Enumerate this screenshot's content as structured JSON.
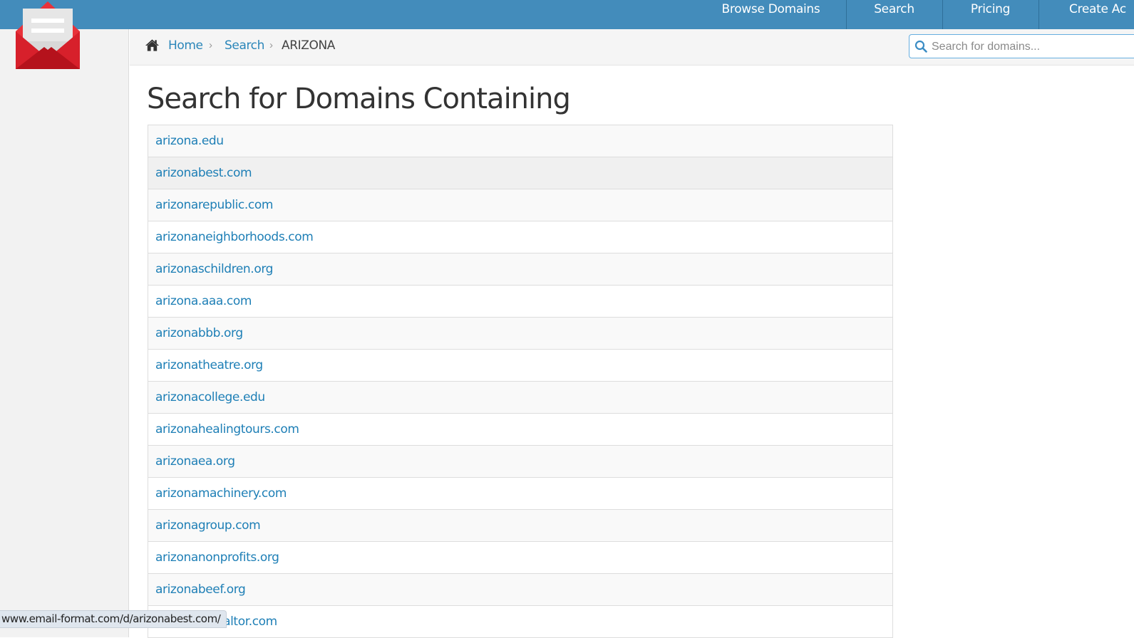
{
  "nav": {
    "items": [
      {
        "label": "Browse Domains"
      },
      {
        "label": "Search"
      },
      {
        "label": "Pricing"
      },
      {
        "label": "Create Ac"
      }
    ]
  },
  "breadcrumb": {
    "home": "Home",
    "search": "Search",
    "current": "ARIZONA"
  },
  "search": {
    "placeholder": "Search for domains..."
  },
  "page": {
    "title": "Search for Domains Containing"
  },
  "domains": [
    "arizona.edu",
    "arizonabest.com",
    "arizonarepublic.com",
    "arizonaneighborhoods.com",
    "arizonaschildren.org",
    "arizona.aaa.com",
    "arizonabbb.org",
    "arizonatheatre.org",
    "arizonacollege.edu",
    "arizonahealingtours.com",
    "arizonaea.org",
    "arizonamachinery.com",
    "arizonagroup.com",
    "arizonanonprofits.org",
    "arizonabeef.org",
    "arizonaacrealtor.com"
  ],
  "status_bar": {
    "url": "www.email-format.com/d/arizonabest.com/"
  },
  "colors": {
    "topbar": "#438cbb",
    "link": "#1e7fb6",
    "logo_red": "#e8323a"
  }
}
